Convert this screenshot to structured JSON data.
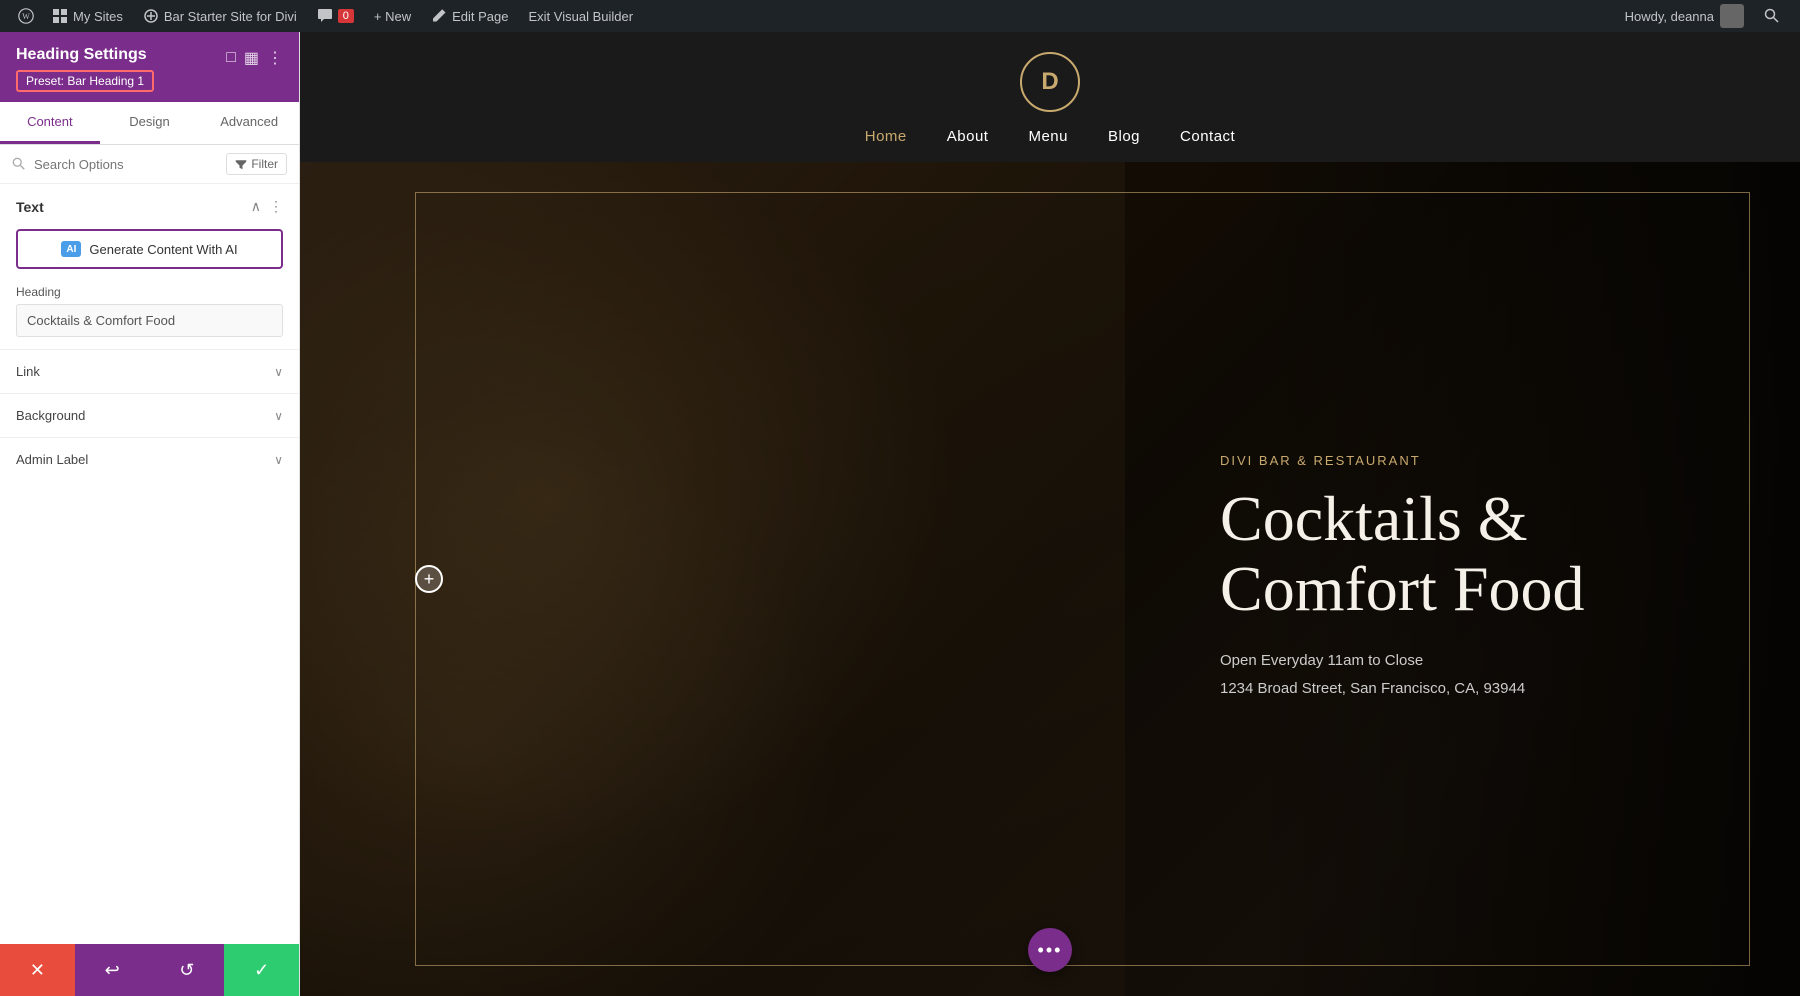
{
  "adminBar": {
    "wpLogoLabel": "W",
    "mySitesLabel": "My Sites",
    "siteNameLabel": "Bar Starter Site for Divi",
    "commentsLabel": "0",
    "newLabel": "+ New",
    "editPageLabel": "Edit Page",
    "exitBuilderLabel": "Exit Visual Builder",
    "howdyLabel": "Howdy, deanna",
    "searchIconLabel": "🔍"
  },
  "sidebar": {
    "title": "Heading Settings",
    "preset": "Preset: Bar Heading 1",
    "tabs": [
      "Content",
      "Design",
      "Advanced"
    ],
    "activeTab": "Content",
    "searchPlaceholder": "Search Options",
    "filterLabel": "Filter",
    "sections": {
      "text": {
        "title": "Text",
        "aiButton": "Generate Content With AI",
        "headingLabel": "Heading",
        "headingValue": "Cocktails & Comfort Food"
      },
      "link": {
        "title": "Link"
      },
      "background": {
        "title": "Background"
      },
      "adminLabel": {
        "title": "Admin Label"
      }
    },
    "bottomBar": {
      "cancel": "✕",
      "undo": "↩",
      "redo": "↺",
      "save": "✓"
    }
  },
  "site": {
    "logoText": "D",
    "nav": [
      "Home",
      "About",
      "Menu",
      "Blog",
      "Contact"
    ],
    "activeNavItem": "Home"
  },
  "hero": {
    "subtitle": "DIVI BAR & RESTAURANT",
    "title": "Cocktails & Comfort Food",
    "line1": "Open Everyday 11am to Close",
    "line2": "1234 Broad Street, San Francisco, CA, 93944"
  },
  "fab": {
    "icon": "•••"
  },
  "icons": {
    "minimize": "⊡",
    "columns": "⊟",
    "more": "⋮",
    "collapse": "∧",
    "moreVert": "⋮",
    "chevronDown": "∨",
    "plus": "+",
    "filter": "⊟",
    "aiIcon": "AI",
    "pencil": "✎",
    "comment": "💬",
    "search": "🔍"
  }
}
